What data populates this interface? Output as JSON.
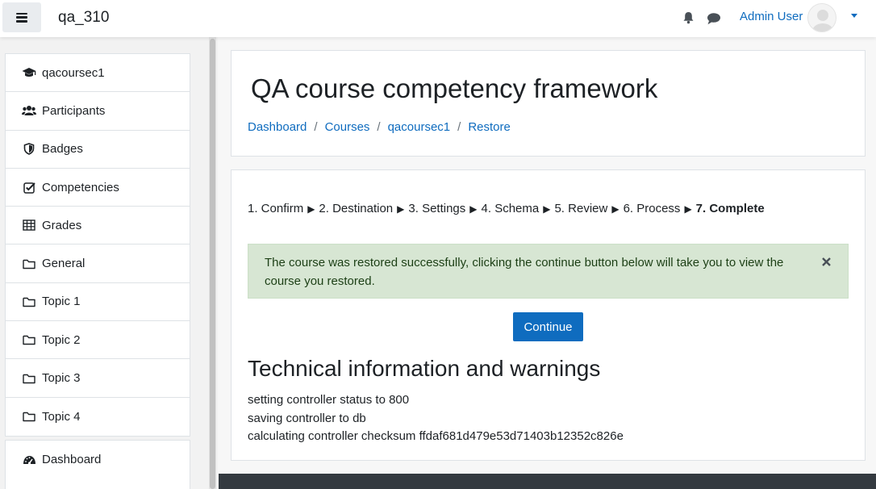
{
  "navbar": {
    "site_name": "qa_310",
    "user_name": "Admin User"
  },
  "sidebar": {
    "items": [
      {
        "label": "qacoursec1",
        "icon": "graduation-cap-icon"
      },
      {
        "label": "Participants",
        "icon": "users-icon"
      },
      {
        "label": "Badges",
        "icon": "shield-icon"
      },
      {
        "label": "Competencies",
        "icon": "check-square-icon"
      },
      {
        "label": "Grades",
        "icon": "table-icon"
      },
      {
        "label": "General",
        "icon": "folder-icon"
      },
      {
        "label": "Topic 1",
        "icon": "folder-icon"
      },
      {
        "label": "Topic 2",
        "icon": "folder-icon"
      },
      {
        "label": "Topic 3",
        "icon": "folder-icon"
      },
      {
        "label": "Topic 4",
        "icon": "folder-icon"
      }
    ],
    "secondary_items": [
      {
        "label": "Dashboard",
        "icon": "dashboard-icon"
      }
    ]
  },
  "header": {
    "title": "QA course competency framework",
    "breadcrumb": [
      "Dashboard",
      "Courses",
      "qacoursec1",
      "Restore"
    ]
  },
  "restore": {
    "steps": [
      "1. Confirm",
      "2. Destination",
      "3. Settings",
      "4. Schema",
      "5. Review",
      "6. Process",
      "7. Complete"
    ],
    "alert_text": "The course was restored successfully, clicking the continue button below will take you to view the course you restored.",
    "continue_label": "Continue",
    "tech_heading": "Technical information and warnings",
    "tech_lines": [
      "setting controller status to 800",
      "saving controller to db",
      "calculating controller checksum ffdaf681d479e53d71403b12352c826e"
    ]
  },
  "colors": {
    "link": "#0f6cbf",
    "alert_bg": "#d7e6d3",
    "footer": "#343a40"
  }
}
